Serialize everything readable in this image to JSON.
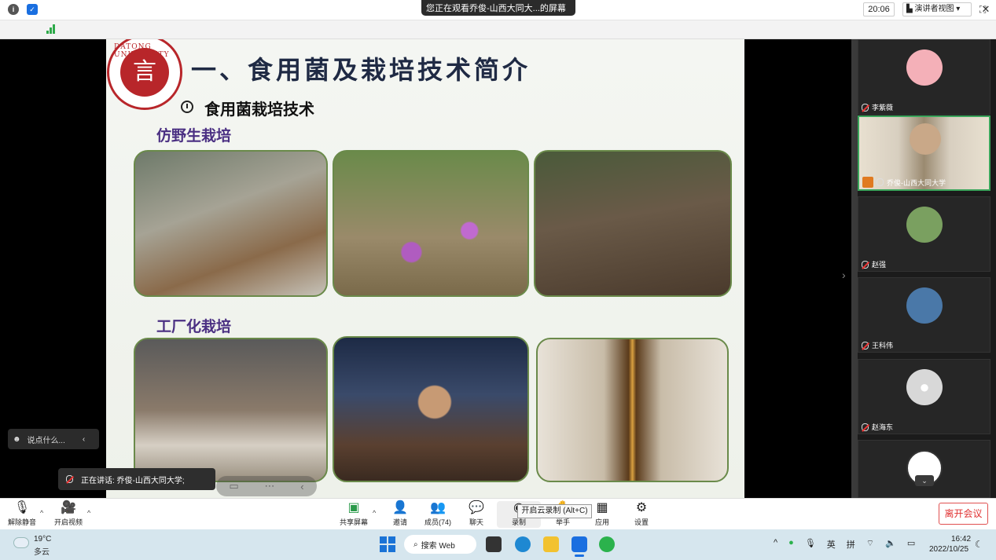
{
  "titlebar": {
    "share_label": "您正在观看乔俊-山西大同大...的屏幕",
    "menu_icon": "hamburger-icon",
    "minimize": "—",
    "restore": "❐",
    "close": "✕"
  },
  "toolbar2": {
    "time": "20:06",
    "view_label": "演讲者视图",
    "view_caret": "▾"
  },
  "slide": {
    "logo_char": "言",
    "logo_ring": "DATONG UNIVERSITY",
    "title": "一、食用菌及栽培技术简介",
    "subtitle": "食用菌栽培技术",
    "section1": "仿野生栽培",
    "section2": "工厂化栽培"
  },
  "participants": [
    {
      "name": "李紫薇",
      "avatar_color": "#f4b0b8"
    },
    {
      "name": "乔俊-山西大同大学",
      "avatar_color": "#c9b8a0"
    },
    {
      "name": "赵强",
      "avatar_color": "#7aa060"
    },
    {
      "name": "王科伟",
      "avatar_color": "#4a78a8"
    },
    {
      "name": "赵海东",
      "avatar_color": "#d8d8d8"
    },
    {
      "name": "",
      "avatar_color": "#ffffff"
    }
  ],
  "overlays": {
    "chat_placeholder": "说点什么...",
    "speaking_label": "正在讲话: 乔俊-山西大同大学;",
    "tooltip": "开启云录制 (Alt+C)"
  },
  "meetbar": {
    "unmute": "解除静音",
    "video": "开启视频",
    "share": "共享屏幕",
    "invite": "邀请",
    "members": "成员(74)",
    "chat": "聊天",
    "record": "录制",
    "raise_hand": "举手",
    "apps": "应用",
    "settings": "设置",
    "leave": "离开会议"
  },
  "taskbar": {
    "temp": "19°C",
    "weather": "多云",
    "search": "搜索 Web",
    "time": "16:42",
    "date": "2022/10/25",
    "lang1": "英",
    "lang2": "拼"
  },
  "colors": {
    "accent_green": "#3ba55c",
    "leave_red": "#e03030",
    "title_navy": "#1f2a44",
    "section_purple": "#4a2f82"
  }
}
